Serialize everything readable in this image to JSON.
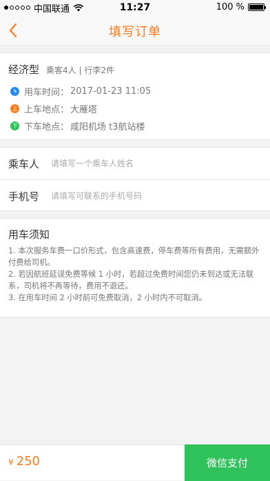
{
  "status_bar": {
    "carrier": "中国联通",
    "time": "11:27",
    "battery": "100 %",
    "battery_level": 1.0
  },
  "nav": {
    "back_icon": "chevron-left-icon",
    "title": "填写订单"
  },
  "trip": {
    "car_type": "经济型",
    "meta": "乘客4人 | 行李2件",
    "rows": [
      {
        "label": "用车时间：",
        "value": "2017-01-23 11:05",
        "icon": "clock-icon",
        "color": "#2a8cf0"
      },
      {
        "label": "上车地点：",
        "value": "大雁塔",
        "icon": "pickup-icon",
        "icon_text": "上",
        "color": "#ff7a1a"
      },
      {
        "label": "下车地点：",
        "value": "咸阳机场 t3航站楼",
        "icon": "dropoff-icon",
        "icon_text": "下",
        "color": "#2fc25b"
      }
    ]
  },
  "form": {
    "passenger_label": "乘车人",
    "passenger_placeholder": "请填写一个乘车人姓名",
    "phone_label": "手机号",
    "phone_placeholder": "请填写可联系的手机号码"
  },
  "notice": {
    "title": "用车须知",
    "items": [
      "1. 本次服务车费一口价形式，包含高速费，停车费等所有费用，无需额外付费给司机。",
      "2. 若因航班延误免费等候 1 小时，若超过免费时间您仍未到达或无法联系，司机将不再等待，费用不退还。",
      "3. 在用车时间 2 小时前可免费取消，2 小时内不可取消。"
    ]
  },
  "footer": {
    "currency": "¥",
    "price": "250",
    "pay_label": "微信支付"
  },
  "colors": {
    "accent": "#ff7a1a",
    "pay_green": "#2fc25b",
    "clock_blue": "#2a8cf0"
  }
}
